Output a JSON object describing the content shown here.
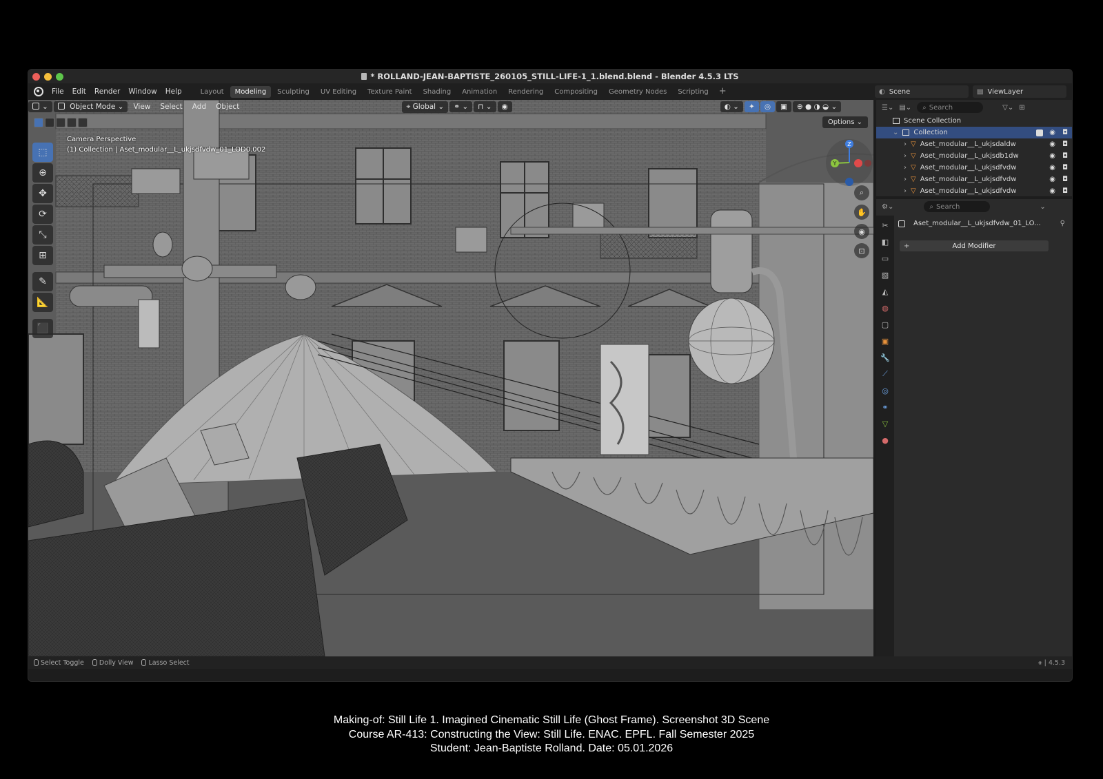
{
  "window": {
    "title": "* ROLLAND-JEAN-BAPTISTE_260105_STILL-LIFE-1_1.blend.blend - Blender 4.5.3 LTS"
  },
  "menu": {
    "items": [
      "File",
      "Edit",
      "Render",
      "Window",
      "Help"
    ],
    "workspaces": [
      {
        "label": "Layout",
        "active": false
      },
      {
        "label": "Modeling",
        "active": true
      },
      {
        "label": "Sculpting",
        "active": false
      },
      {
        "label": "UV Editing",
        "active": false
      },
      {
        "label": "Texture Paint",
        "active": false
      },
      {
        "label": "Shading",
        "active": false
      },
      {
        "label": "Animation",
        "active": false
      },
      {
        "label": "Rendering",
        "active": false
      },
      {
        "label": "Compositing",
        "active": false
      },
      {
        "label": "Geometry Nodes",
        "active": false
      },
      {
        "label": "Scripting",
        "active": false
      }
    ],
    "add_workspace": "+",
    "scene": "Scene",
    "view_layer": "ViewLayer"
  },
  "viewport": {
    "mode": "Object Mode",
    "menus": [
      "View",
      "Select",
      "Add",
      "Object"
    ],
    "transform_orientation": "Global",
    "options": "Options",
    "overlay_line1": "Camera Perspective",
    "overlay_line2": "(1) Collection | Aset_modular__L_ukjsdfvdw_01_LOD0.002",
    "gizmo": {
      "x": "Y",
      "z": "Z"
    },
    "tools": [
      "select-box",
      "cursor",
      "move",
      "rotate",
      "scale",
      "transform",
      "annotate",
      "measure",
      "add-cube"
    ]
  },
  "outliner": {
    "search_placeholder": "Search",
    "scene_collection": "Scene Collection",
    "collection": "Collection",
    "objects": [
      "Aset_modular__L_ukjsdaldw",
      "Aset_modular__L_ukjsdb1dw",
      "Aset_modular__L_ukjsdfvdw",
      "Aset_modular__L_ukjsdfvdw",
      "Aset_modular__L_ukjsdfvdw"
    ]
  },
  "properties": {
    "search_placeholder": "Search",
    "object_name": "Aset_modular__L_ukjsdfvdw_01_LO...",
    "add_modifier": "Add Modifier"
  },
  "statusbar": {
    "select_toggle": "Select Toggle",
    "dolly_view": "Dolly View",
    "lasso_select": "Lasso Select",
    "version": "4.5.3"
  },
  "caption": {
    "line1": "Making-of: Still Life 1. Imagined Cinematic Still Life (Ghost Frame). Screenshot 3D Scene",
    "line2": "Course AR-413: Constructing the View: Still Life. ENAC. EPFL. Fall Semester 2025",
    "line3": "Student: Jean-Baptiste Rolland. Date: 05.01.2026"
  },
  "colors": {
    "accent": "#4772b3",
    "mesh_icon": "#e8923b",
    "close": "#ec5f5a",
    "minimize": "#f5bf3c",
    "maximize": "#5ec64b",
    "axis_x": "#e04a4a",
    "axis_y": "#8cc53f",
    "axis_z": "#3f7ee0"
  }
}
